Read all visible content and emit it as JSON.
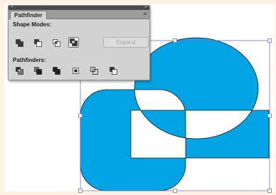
{
  "panel": {
    "close_glyph": "×",
    "collapse_glyph": "»",
    "tab_label": "Pathfinder",
    "menu_glyph": "≡",
    "shape_modes_label": "Shape Modes:",
    "pathfinders_label": "Pathfinders:",
    "expand_label": "Expand",
    "shape_mode_buttons": [
      "unite-icon",
      "minus-front-icon",
      "intersect-icon",
      "exclude-icon"
    ],
    "selected_shape_mode": "exclude-icon",
    "pathfinder_buttons": [
      "divide-icon",
      "trim-icon",
      "merge-icon",
      "crop-icon",
      "outline-icon",
      "minus-back-icon"
    ]
  },
  "colors": {
    "shape_fill": "#00a4e4",
    "selection": "#7b72b8",
    "panel_bg": "#d3d3d3"
  }
}
